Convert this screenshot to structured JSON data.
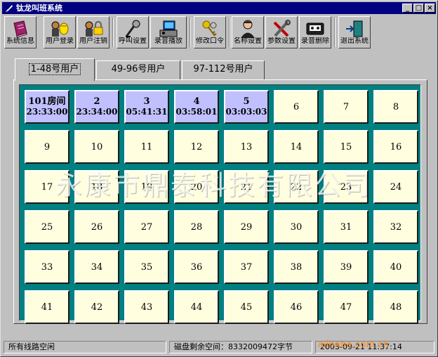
{
  "window": {
    "title": "钛龙叫班系统"
  },
  "titlebar_buttons": {
    "minimize": "_",
    "maximize": "□",
    "close": "×"
  },
  "toolbar": [
    {
      "label": "系统信息",
      "icon": "book-icon"
    },
    {
      "label": "用户登录",
      "icon": "user-login-icon"
    },
    {
      "label": "用户注销",
      "icon": "user-logout-icon"
    },
    {
      "label": "呼叫设置",
      "icon": "microphone-icon"
    },
    {
      "label": "录音播放",
      "icon": "playback-icon"
    },
    {
      "label": "修改口令",
      "icon": "keys-icon"
    },
    {
      "label": "名称设置",
      "icon": "person-icon"
    },
    {
      "label": "参数设置",
      "icon": "tools-icon"
    },
    {
      "label": "录音删除",
      "icon": "tape-icon"
    },
    {
      "label": "退出系统",
      "icon": "exit-door-icon"
    }
  ],
  "tabs": [
    {
      "label": "1-48号用户",
      "active": true
    },
    {
      "label": "49-96号用户",
      "active": false
    },
    {
      "label": "97-112号用户",
      "active": false
    }
  ],
  "cells": [
    {
      "num": "101房间",
      "time": "23:33:00",
      "busy": true
    },
    {
      "num": "2",
      "time": "23:34:00",
      "busy": true
    },
    {
      "num": "3",
      "time": "05:41:31",
      "busy": true
    },
    {
      "num": "4",
      "time": "03:58:01",
      "busy": true
    },
    {
      "num": "5",
      "time": "03:03:03",
      "busy": true
    },
    {
      "num": "6"
    },
    {
      "num": "7"
    },
    {
      "num": "8"
    },
    {
      "num": "9"
    },
    {
      "num": "10"
    },
    {
      "num": "11"
    },
    {
      "num": "12"
    },
    {
      "num": "13"
    },
    {
      "num": "14"
    },
    {
      "num": "15"
    },
    {
      "num": "16"
    },
    {
      "num": "17"
    },
    {
      "num": "18"
    },
    {
      "num": "19"
    },
    {
      "num": "20"
    },
    {
      "num": "21"
    },
    {
      "num": "22"
    },
    {
      "num": "23"
    },
    {
      "num": "24"
    },
    {
      "num": "25"
    },
    {
      "num": "26"
    },
    {
      "num": "27"
    },
    {
      "num": "28"
    },
    {
      "num": "29"
    },
    {
      "num": "30"
    },
    {
      "num": "31"
    },
    {
      "num": "32"
    },
    {
      "num": "33"
    },
    {
      "num": "34"
    },
    {
      "num": "35"
    },
    {
      "num": "36"
    },
    {
      "num": "37"
    },
    {
      "num": "38"
    },
    {
      "num": "39"
    },
    {
      "num": "40"
    },
    {
      "num": "41"
    },
    {
      "num": "42"
    },
    {
      "num": "43"
    },
    {
      "num": "44"
    },
    {
      "num": "45"
    },
    {
      "num": "46"
    },
    {
      "num": "47"
    },
    {
      "num": "48"
    }
  ],
  "watermark": "永康市鼎泰科技有限公司",
  "status": {
    "line_status": "所有线路空闲",
    "disk_space": "磁盘剩余空间：8332009472字节",
    "datetime": "2003-09-21  11:37:14"
  },
  "brandmark": "alibaba.com.cn",
  "colors": {
    "titlebar": "#000080",
    "grid_bg": "#008080",
    "cell_idle": "#ffffe0",
    "cell_busy": "#c0c0ff",
    "brandmark": "#ff8a1c"
  }
}
